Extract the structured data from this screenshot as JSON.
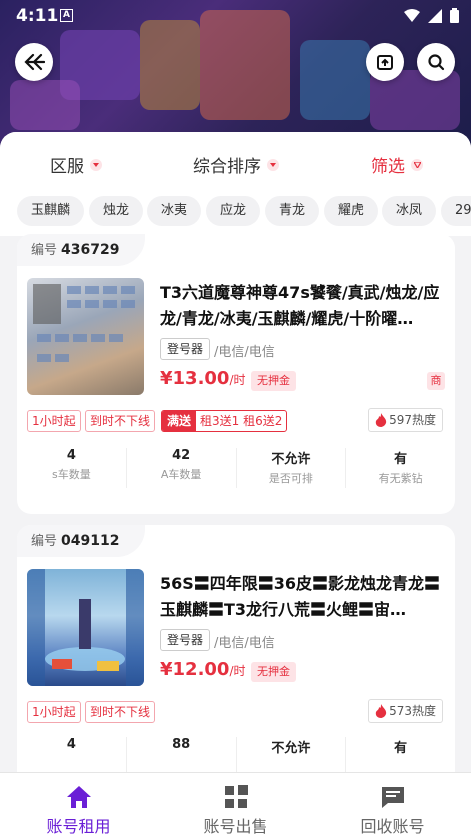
{
  "status_bar": {
    "time": "4:11",
    "notif_badge": "A"
  },
  "filters": {
    "region": "区服",
    "sort": "综合排序",
    "filter": "筛选"
  },
  "chips": [
    "玉麒麟",
    "烛龙",
    "冰夷",
    "应龙",
    "青龙",
    "耀虎",
    "冰凤",
    "29"
  ],
  "colors": {
    "accent_red": "#e5303f",
    "accent_purple": "#6a1fd6"
  },
  "listings": [
    {
      "id_label": "编号",
      "id": "436729",
      "title": "T3六道魔尊神尊47s饕餮/真武/烛龙/应龙/青龙/冰夷/玉麒麟/耀虎/十阶曜…",
      "login_tag": "登号器",
      "carrier": "/电信/电信",
      "price": "¥13.00",
      "price_unit": "/时",
      "deposit": "无押金",
      "merchant_badge": "商",
      "min_rent": "1小时起",
      "auto_offline": "到时不下线",
      "promo_head": "满送",
      "promo_body": "租3送1  租6送2",
      "heat": "597热度",
      "stats": [
        {
          "value": "4",
          "label": "s车数量"
        },
        {
          "value": "42",
          "label": "A车数量"
        },
        {
          "value": "不允许",
          "label": "是否可排"
        },
        {
          "value": "有",
          "label": "有无紫钻"
        }
      ]
    },
    {
      "id_label": "编号",
      "id": "049112",
      "title": "56S〓四年限〓36皮〓影龙烛龙青龙〓玉麒麟〓T3龙行八荒〓火鲤〓宙…",
      "login_tag": "登号器",
      "carrier": "/电信/电信",
      "price": "¥12.00",
      "price_unit": "/时",
      "deposit": "无押金",
      "min_rent": "1小时起",
      "auto_offline": "到时不下线",
      "heat": "573热度",
      "stats": [
        {
          "value": "4",
          "label": ""
        },
        {
          "value": "88",
          "label": ""
        },
        {
          "value": "不允许",
          "label": ""
        },
        {
          "value": "有",
          "label": ""
        }
      ]
    }
  ],
  "tabbar": [
    {
      "label": "账号租用",
      "icon": "home-icon"
    },
    {
      "label": "账号出售",
      "icon": "grid-icon"
    },
    {
      "label": "回收账号",
      "icon": "message-icon"
    }
  ]
}
